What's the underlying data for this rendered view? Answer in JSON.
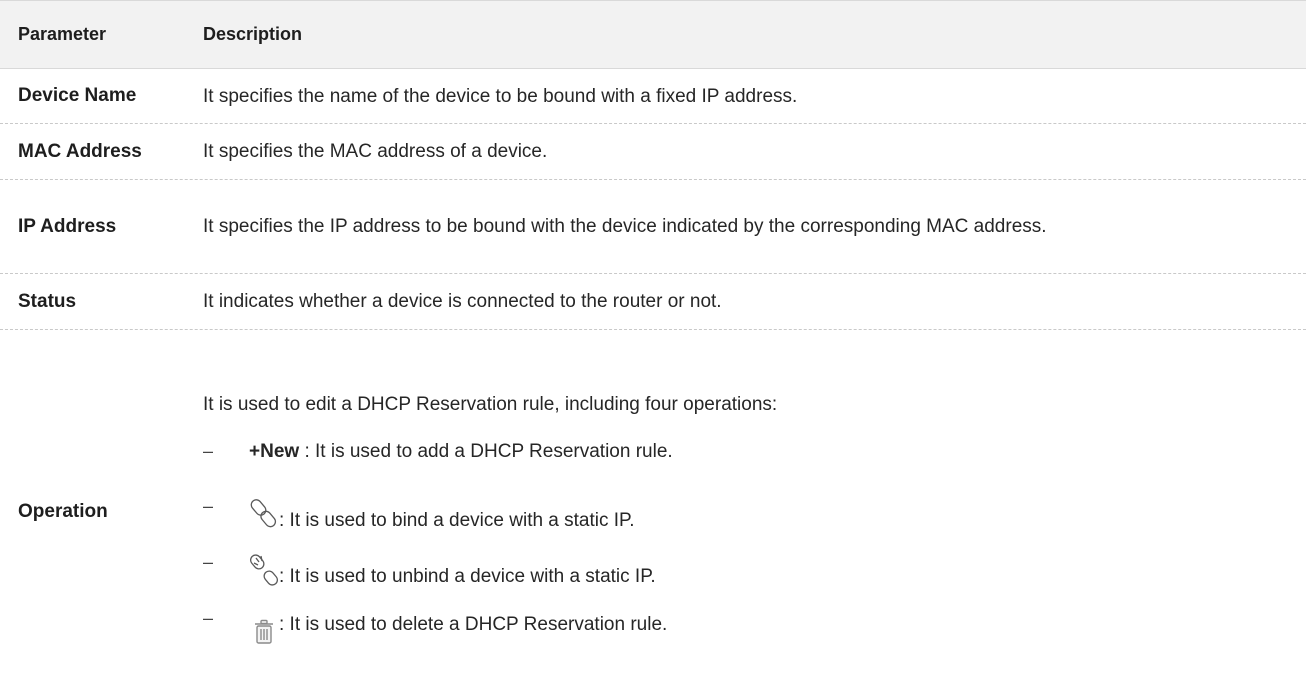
{
  "table": {
    "header": {
      "parameter": "Parameter",
      "description": "Description"
    },
    "rows": [
      {
        "parameter": "Device Name",
        "description": "It specifies the name of the device to be bound with a fixed IP address."
      },
      {
        "parameter": "MAC Address",
        "description": "It specifies the MAC address of a device."
      },
      {
        "parameter": "IP Address",
        "description": "It specifies the IP address to be bound with the device indicated by the corresponding MAC address."
      },
      {
        "parameter": "Status",
        "description": "It indicates whether a device is connected to the router or not."
      }
    ],
    "operation": {
      "parameter": "Operation",
      "intro": "It is used to edit a DHCP Reservation rule, including four operations:",
      "items": [
        {
          "dash": "–",
          "label": "+New",
          "text": " : It is used to add a DHCP Reservation rule."
        },
        {
          "dash": "–",
          "icon": "link-icon",
          "text": ": It is used to bind a device with a static IP."
        },
        {
          "dash": "–",
          "icon": "unlink-icon",
          "text": ": It is used to unbind a device with a static IP."
        },
        {
          "dash": "–",
          "icon": "trash-icon",
          "text": ": It is used to delete a DHCP Reservation rule."
        }
      ]
    }
  }
}
